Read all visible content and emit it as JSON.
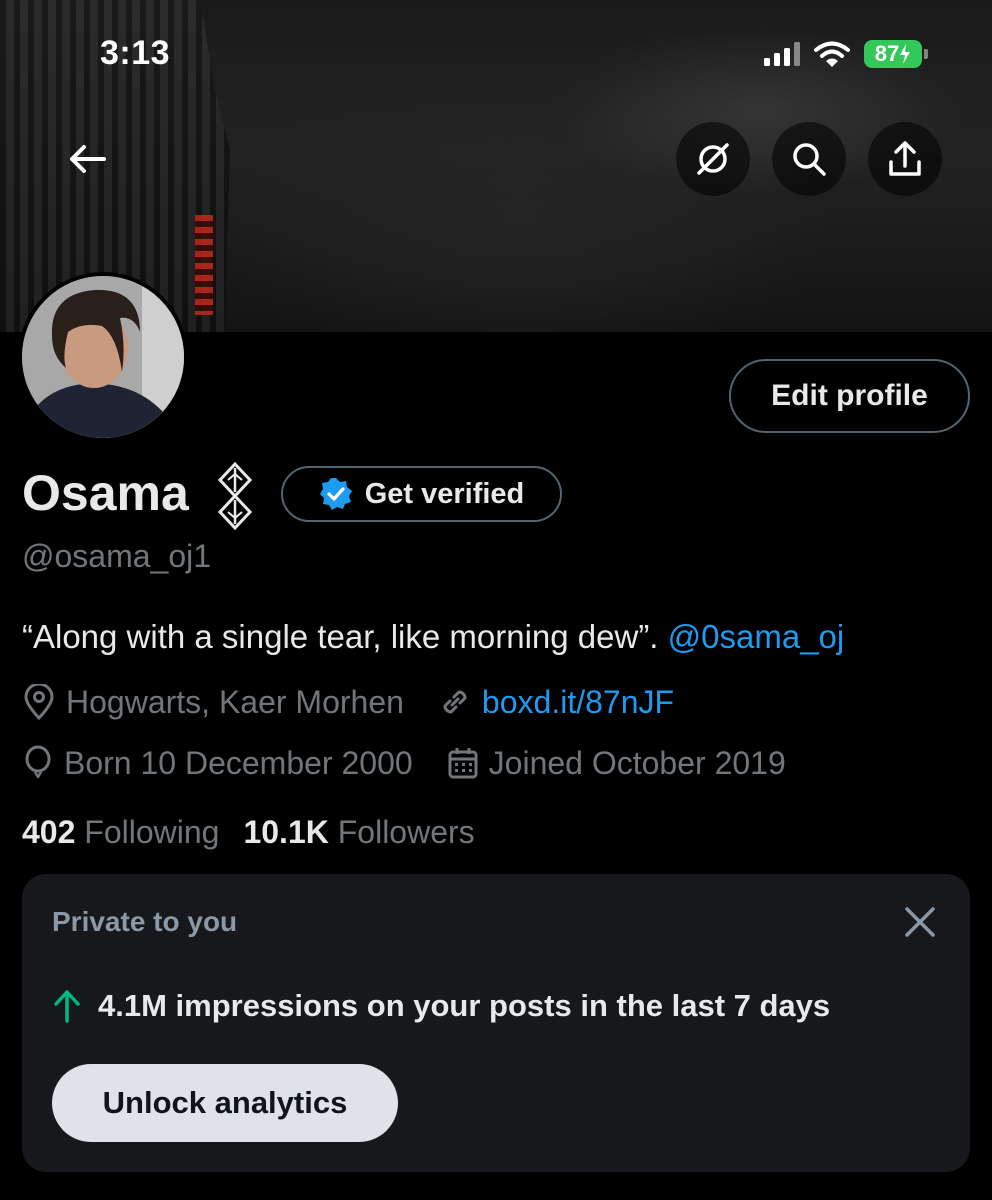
{
  "status_bar": {
    "time": "3:13",
    "battery_level": "87"
  },
  "header": {
    "back_icon": "arrow-left-icon",
    "actions": [
      {
        "icon": "grok-icon"
      },
      {
        "icon": "search-icon"
      },
      {
        "icon": "share-icon"
      }
    ]
  },
  "profile": {
    "edit_button": "Edit profile",
    "name": "Osama",
    "verify_button": "Get verified",
    "handle": "@osama_oj1",
    "bio_text": "“Along with a single tear, like morning dew”. ",
    "bio_mention": "@0sama_oj",
    "location": "Hogwarts, Kaer Morhen",
    "link": "boxd.it/87nJF",
    "born": "Born 10 December 2000",
    "joined": "Joined October 2019",
    "following_count": "402",
    "following_label": "Following",
    "followers_count": "10.1K",
    "followers_label": "Followers"
  },
  "analytics_card": {
    "label": "Private to you",
    "impressions_text": "4.1M impressions on your posts in the last 7 days",
    "unlock_button": "Unlock analytics"
  },
  "colors": {
    "background": "#000000",
    "accent": "#1d9bf0",
    "secondary_text": "#71767b",
    "trend_up": "#00ba7c",
    "battery": "#34c759"
  }
}
